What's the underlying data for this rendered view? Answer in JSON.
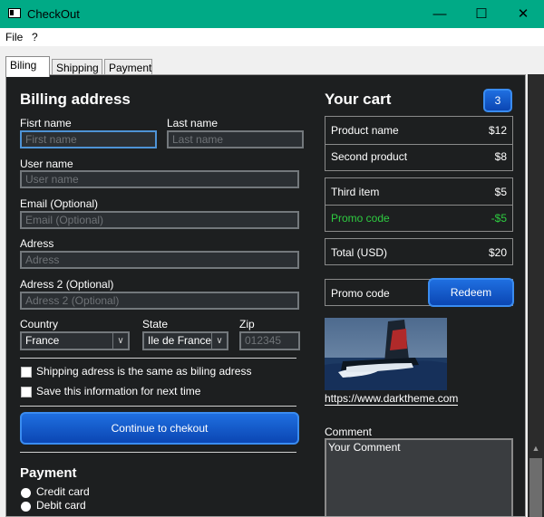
{
  "window": {
    "title": "CheckOut",
    "minimize": "—",
    "maximize": "☐",
    "close": "✕"
  },
  "menu": {
    "file": "File",
    "help": "?"
  },
  "tabs": [
    "Biling",
    "Shipping",
    "Payment"
  ],
  "billing": {
    "heading": "Billing address",
    "first_name_label": "Fisrt name",
    "first_name_placeholder": "First name",
    "last_name_label": "Last name",
    "last_name_placeholder": "Last name",
    "username_label": "User name",
    "username_placeholder": "User name",
    "email_label": "Email (Optional)",
    "email_placeholder": "Email (Optional)",
    "address_label": "Adress",
    "address_placeholder": "Adress",
    "address2_label": "Adress 2 (Optional)",
    "address2_placeholder": "Adress 2 (Optional)",
    "country_label": "Country",
    "country_value": "France",
    "state_label": "State",
    "state_value": "Ile de France",
    "zip_label": "Zip",
    "zip_placeholder": "012345",
    "same_address_label": "Shipping adress is the same as biling adress",
    "save_info_label": "Save this information for next time",
    "continue_button": "Continue to chekout"
  },
  "payment": {
    "heading": "Payment",
    "options": [
      "Credit card",
      "Debit card"
    ]
  },
  "cart": {
    "heading": "Your cart",
    "count": "3",
    "items": [
      {
        "name": "Product name",
        "price": "$12"
      },
      {
        "name": "Second product",
        "price": "$8"
      },
      {
        "name": "Third item",
        "price": "$5"
      }
    ],
    "promo_line": {
      "name": "Promo code",
      "price": "-$5"
    },
    "total": {
      "name": "Total (USD)",
      "price": "$20"
    },
    "promo_label": "Promo code",
    "redeem_button": "Redeem",
    "image_link": "https://www.darktheme.com",
    "comment_label": "Comment",
    "comment_value": "Your Comment"
  },
  "colors": {
    "titlebar": "#00aa86",
    "panel": "#1d1f20",
    "accent_blue": "#1f6fe0",
    "promo_green": "#2ecc40"
  }
}
